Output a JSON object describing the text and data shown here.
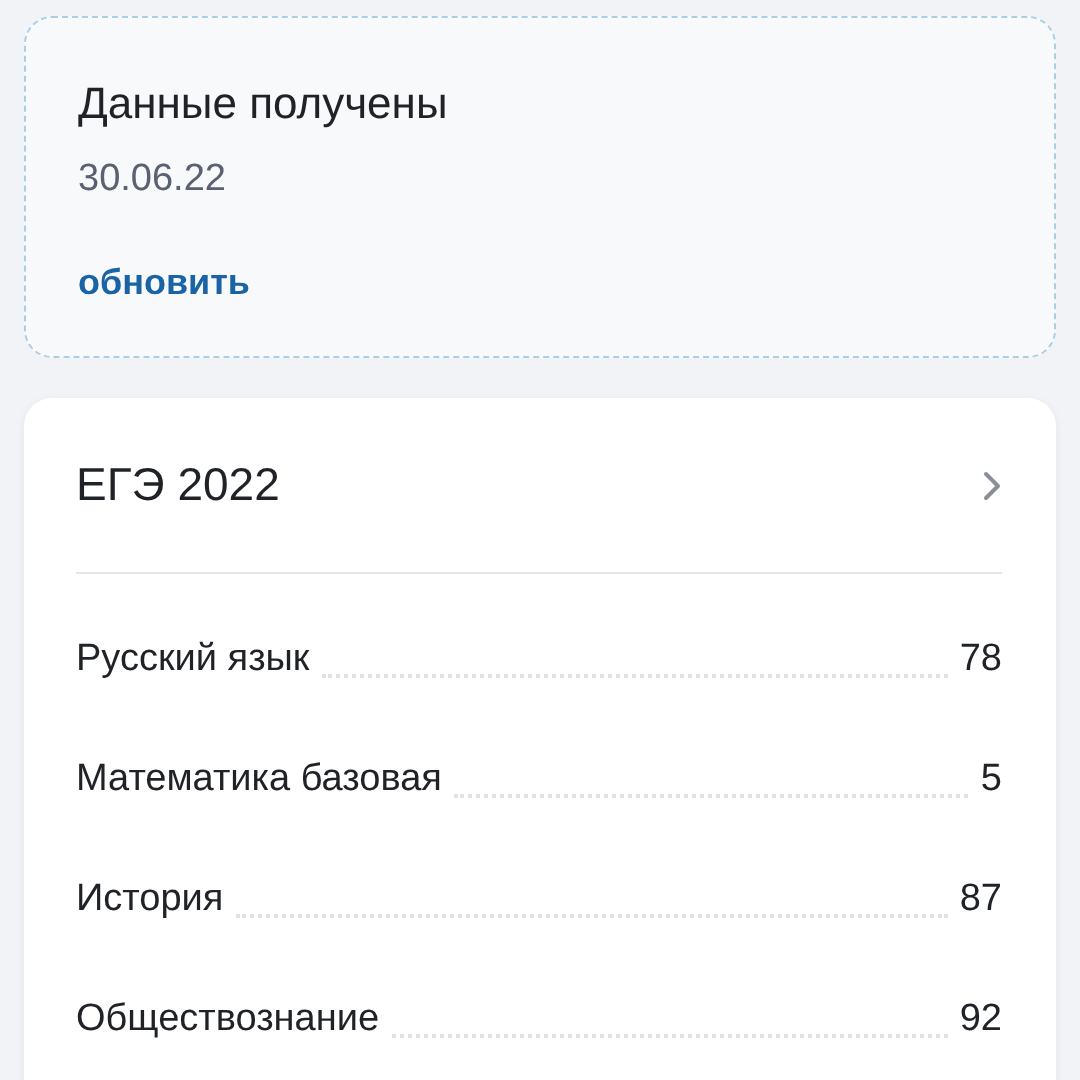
{
  "status_card": {
    "title": "Данные получены",
    "date": "30.06.22",
    "link": "обновить"
  },
  "exam_card": {
    "title": "ЕГЭ 2022",
    "subjects": [
      {
        "name": "Русский язык",
        "score": "78"
      },
      {
        "name": "Математика базовая",
        "score": "5"
      },
      {
        "name": "История",
        "score": "87"
      },
      {
        "name": "Обществознание",
        "score": "92"
      }
    ]
  }
}
